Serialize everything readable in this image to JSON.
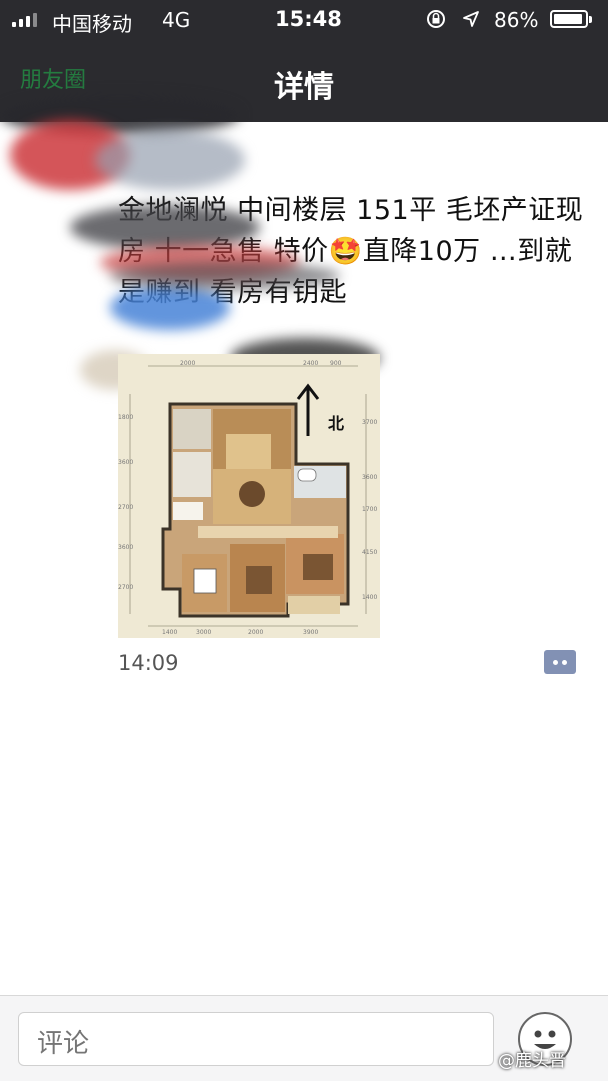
{
  "status_bar": {
    "carrier": "中国移动",
    "network": "4G",
    "time": "15:48",
    "battery": "86%"
  },
  "nav": {
    "title": "详情",
    "back_label": "朋友圈"
  },
  "post": {
    "text": "金地澜悦 中间楼层 151平 毛坯产证现房 十一急售 特价🤩直降10万 …到就是赚到 看房有钥匙",
    "time": "14:09",
    "floorplan": {
      "north_label": "北",
      "dimensions_top": [
        "2000",
        "2400",
        "900"
      ],
      "dimensions_bottom": [
        "1400",
        "3000",
        "2000",
        "3900"
      ],
      "dimensions_left": [
        "1800",
        "3600",
        "2700",
        "3600",
        "2700"
      ],
      "dimensions_right": [
        "3700",
        "3600",
        "1700",
        "4150",
        "1400"
      ]
    }
  },
  "bottom_bar": {
    "comment_placeholder": "评论",
    "watermark": "@鹿头晋"
  },
  "colors": {
    "bar_bg": "#2b2b2f",
    "comment_icon": "#8291b4"
  }
}
